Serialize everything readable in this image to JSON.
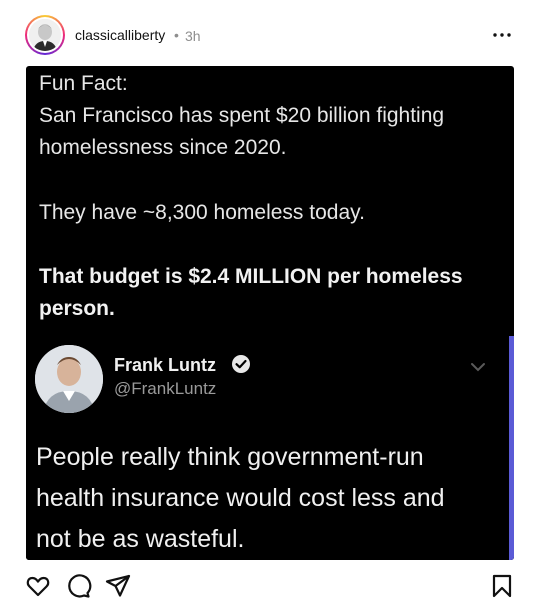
{
  "header": {
    "username": "classicalliberty",
    "separator": "•",
    "time": "3h"
  },
  "post_image": {
    "lines": [
      "Fun Fact:",
      "San Francisco has spent $20 billion fighting",
      "homelessness since 2020.",
      "They have ~8,300 homeless today."
    ],
    "bold_lines": [
      "That budget is $2.4 MILLION per homeless",
      "person."
    ],
    "embedded_tweet": {
      "name": "Frank Luntz",
      "handle": "@FrankLuntz",
      "text_lines": [
        "People really think government-run",
        "health insurance would cost less and",
        "not be as wasteful."
      ]
    }
  },
  "actions": {
    "icons": [
      "heart-icon",
      "comment-icon",
      "share-icon",
      "bookmark-icon"
    ]
  },
  "colors": {
    "embed_accent": "#5b5bd6",
    "post_background": "#000000",
    "meta_gray": "#8e8e8e"
  }
}
